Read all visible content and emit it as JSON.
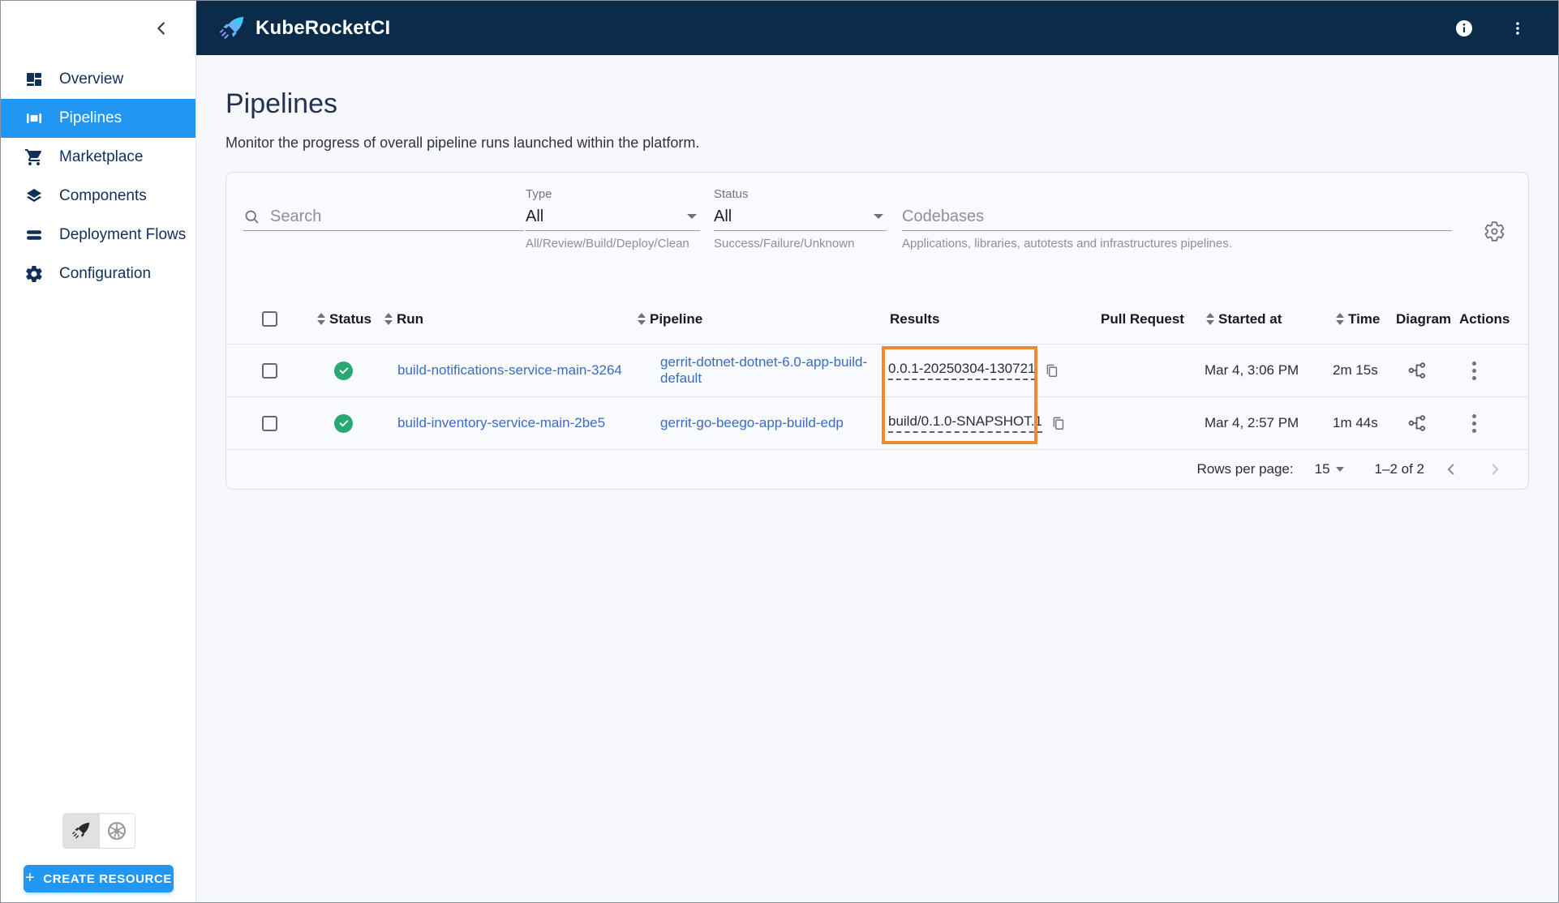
{
  "header": {
    "app_title": "KubeRocketCI"
  },
  "sidebar": {
    "items": [
      {
        "label": "Overview"
      },
      {
        "label": "Pipelines"
      },
      {
        "label": "Marketplace"
      },
      {
        "label": "Components"
      },
      {
        "label": "Deployment Flows"
      },
      {
        "label": "Configuration"
      }
    ],
    "create_button_label": "CREATE RESOURCE",
    "create_button_plus": "+"
  },
  "page": {
    "title": "Pipelines",
    "subtitle": "Monitor the progress of overall pipeline runs launched within the platform."
  },
  "filters": {
    "search": {
      "placeholder": "Search"
    },
    "type": {
      "label": "Type",
      "value": "All",
      "helper": "All/Review/Build/Deploy/Clean"
    },
    "status": {
      "label": "Status",
      "value": "All",
      "helper": "Success/Failure/Unknown"
    },
    "codebases": {
      "placeholder": "Codebases",
      "helper": "Applications, libraries, autotests and infrastructures pipelines."
    }
  },
  "table": {
    "columns": {
      "status": "Status",
      "run": "Run",
      "pipeline": "Pipeline",
      "results": "Results",
      "pull_request": "Pull Request",
      "started_at": "Started at",
      "time": "Time",
      "diagram": "Diagram",
      "actions": "Actions"
    },
    "rows": [
      {
        "status": "success",
        "run": "build-notifications-service-main-3264",
        "pipeline": "gerrit-dotnet-dotnet-6.0-app-build-default",
        "result": "0.0.1-20250304-130721",
        "pull_request": "",
        "started_at": "Mar 4, 3:06 PM",
        "time": "2m 15s"
      },
      {
        "status": "success",
        "run": "build-inventory-service-main-2be5",
        "pipeline": "gerrit-go-beego-app-build-edp",
        "result": "build/0.1.0-SNAPSHOT.1",
        "pull_request": "",
        "started_at": "Mar 4, 2:57 PM",
        "time": "1m 44s"
      }
    ],
    "pagination": {
      "rows_per_page_label": "Rows per page:",
      "rows_per_page_value": "15",
      "range": "1–2 of 2"
    }
  },
  "colors": {
    "header_bg": "#0b2b4b",
    "accent_blue": "#2196f3",
    "link_blue": "#3a6cc4",
    "success_green": "#2aa873",
    "highlight_orange": "#ef8b2b"
  }
}
